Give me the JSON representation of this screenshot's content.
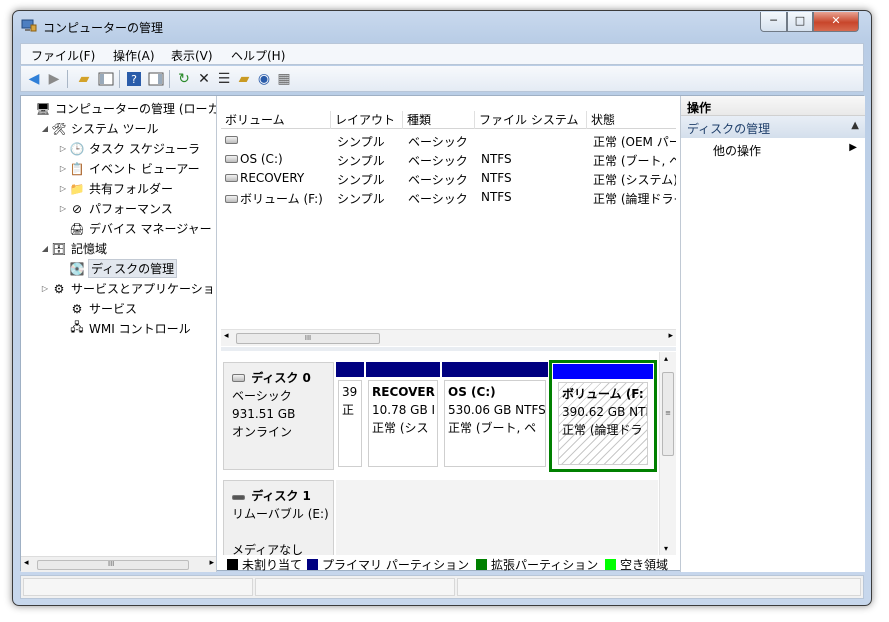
{
  "window": {
    "title": "コンピューターの管理",
    "minimize": "─",
    "maximize": "□",
    "close": "✕"
  },
  "menu": [
    "ファイル(F)",
    "操作(A)",
    "表示(V)",
    "ヘルプ(H)"
  ],
  "tree": [
    {
      "label": "コンピューターの管理 (ローカル)",
      "icon": "computer-icon",
      "level": 0,
      "expander": ""
    },
    {
      "label": "システム ツール",
      "icon": "tools-icon",
      "level": 1,
      "expander": "◢"
    },
    {
      "label": "タスク スケジューラ",
      "icon": "clock-icon",
      "level": 2,
      "expander": "▷"
    },
    {
      "label": "イベント ビューアー",
      "icon": "event-viewer-icon",
      "level": 2,
      "expander": "▷"
    },
    {
      "label": "共有フォルダー",
      "icon": "shared-folder-icon",
      "level": 2,
      "expander": "▷"
    },
    {
      "label": "パフォーマンス",
      "icon": "performance-icon",
      "level": 2,
      "expander": "▷"
    },
    {
      "label": "デバイス マネージャー",
      "icon": "device-manager-icon",
      "level": 2,
      "expander": ""
    },
    {
      "label": "記憶域",
      "icon": "storage-icon",
      "level": 1,
      "expander": "◢"
    },
    {
      "label": "ディスクの管理",
      "icon": "disk-management-icon",
      "level": 2,
      "expander": "",
      "selected": true
    },
    {
      "label": "サービスとアプリケーション",
      "icon": "services-apps-icon",
      "level": 1,
      "expander": "▷"
    },
    {
      "label": "サービス",
      "icon": "services-icon",
      "level": 2,
      "expander": ""
    },
    {
      "label": "WMI コントロール",
      "icon": "wmi-icon",
      "level": 2,
      "expander": ""
    }
  ],
  "volumes": {
    "columns": [
      "ボリューム",
      "レイアウト",
      "種類",
      "ファイル システム",
      "状態"
    ],
    "rows": [
      {
        "name": "",
        "layout": "シンプル",
        "type": "ベーシック",
        "fs": "",
        "status": "正常 (OEM パーティション)"
      },
      {
        "name": "OS (C:)",
        "layout": "シンプル",
        "type": "ベーシック",
        "fs": "NTFS",
        "status": "正常 (ブート, ページ ファイル)"
      },
      {
        "name": "RECOVERY",
        "layout": "シンプル",
        "type": "ベーシック",
        "fs": "NTFS",
        "status": "正常 (システム)"
      },
      {
        "name": "ボリューム (F:)",
        "layout": "シンプル",
        "type": "ベーシック",
        "fs": "NTFS",
        "status": "正常 (論理ドライブ)"
      }
    ],
    "hscroll_grip": "III"
  },
  "disks": [
    {
      "title": "ディスク 0",
      "kind": "ベーシック",
      "size": "931.51 GB",
      "state": "オンライン",
      "partitions": [
        {
          "name": "",
          "size": "39",
          "status": "正",
          "kind": "primary"
        },
        {
          "name": "RECOVER",
          "size": "10.78 GB I",
          "status": "正常 (シス",
          "kind": "primary"
        },
        {
          "name": "OS  (C:)",
          "size": "530.06 GB NTFS",
          "status": "正常 (ブート, ペ",
          "kind": "primary"
        },
        {
          "name": "ボリューム  (F:",
          "size": "390.62 GB NTI",
          "status": "正常 (論理ドラ",
          "kind": "logical"
        }
      ]
    },
    {
      "title": "ディスク 1",
      "kind": "リムーバブル (E:)",
      "size": "",
      "state": "メディアなし",
      "partitions": []
    }
  ],
  "disk_vscroll_grip": "≡",
  "legend": [
    {
      "label": "未割り当て",
      "color": "#000000"
    },
    {
      "label": "プライマリ パーティション",
      "color": "#000080"
    },
    {
      "label": "拡張パーティション",
      "color": "#008000"
    },
    {
      "label": "空き領域",
      "color": "#00ff00"
    }
  ],
  "actions": {
    "header": "操作",
    "section": "ディスクの管理",
    "section_caret": "▲",
    "items": [
      {
        "label": "他の操作",
        "arrow": "▶"
      }
    ]
  },
  "tree_hscroll_grip": "III",
  "colors": {
    "primary": "#000080",
    "logical_header": "#0000ff",
    "extended": "#008000",
    "free": "#00ff00"
  }
}
